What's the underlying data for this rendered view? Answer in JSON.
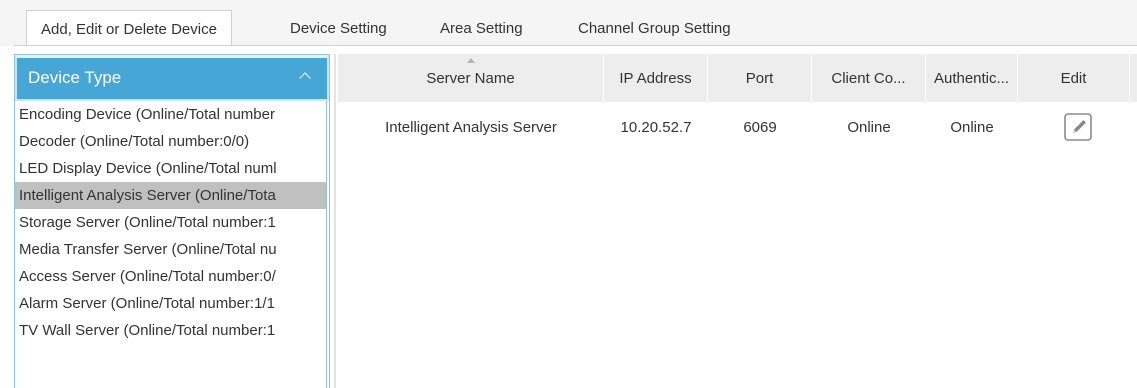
{
  "tabs": [
    {
      "label": "Add, Edit or Delete Device",
      "active": true
    },
    {
      "label": "Device Setting",
      "active": false
    },
    {
      "label": "Area Setting",
      "active": false
    },
    {
      "label": "Channel Group Setting",
      "active": false
    }
  ],
  "device_panel": {
    "title": "Device Type",
    "items": [
      {
        "label": "Encoding Device (Online/Total number"
      },
      {
        "label": "Decoder (Online/Total number:0/0)"
      },
      {
        "label": "LED Display Device (Online/Total numl"
      },
      {
        "label": "Intelligent Analysis Server (Online/Tota",
        "selected": true
      },
      {
        "label": "Storage Server (Online/Total number:1"
      },
      {
        "label": "Media Transfer Server (Online/Total nu"
      },
      {
        "label": "Access Server (Online/Total number:0/"
      },
      {
        "label": "Alarm Server (Online/Total number:1/1"
      },
      {
        "label": "TV Wall Server (Online/Total number:1"
      }
    ]
  },
  "table": {
    "columns": [
      "Server Name",
      "IP Address",
      "Port",
      "Client Co...",
      "Authentic...",
      "Edit"
    ],
    "rows": [
      {
        "server_name": "Intelligent Analysis Server",
        "ip_address": "10.20.52.7",
        "port": "6069",
        "client_connection": "Online",
        "authentication": "Online",
        "edit_icon": "edit-icon"
      }
    ]
  },
  "colors": {
    "header_blue": "#46a6d6",
    "selected_row": "#c0c0c0",
    "table_header_bg": "#ededed"
  }
}
